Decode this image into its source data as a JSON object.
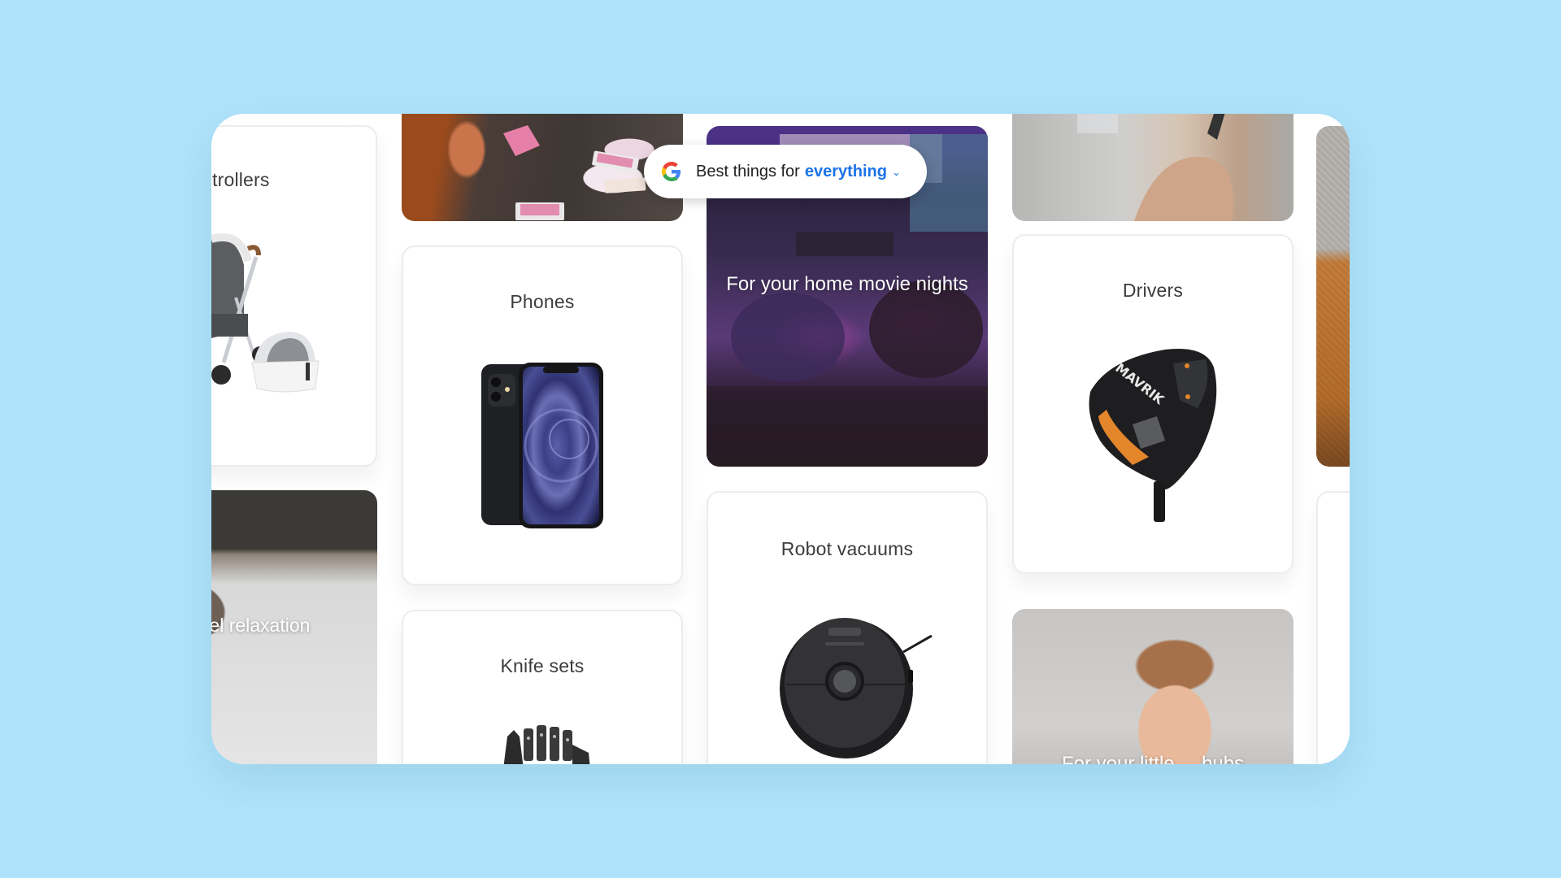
{
  "colors": {
    "background": "#afe3fb",
    "frame": "#ffffff",
    "accent": "#1a73e8",
    "title_text": "#3c3c3c"
  },
  "search_pill": {
    "icon": "google-g-icon",
    "prefix": "Best things for",
    "selected": "everything",
    "chevron_icon": "chevron-down-icon"
  },
  "columns": [
    {
      "cards": [
        {
          "type": "product",
          "title": "trollers",
          "image": "stroller-image"
        },
        {
          "type": "photo",
          "caption": "level relaxation",
          "image": "relaxation-photo"
        }
      ]
    },
    {
      "cards": [
        {
          "type": "photo",
          "caption": "",
          "image": "card-game-photo"
        },
        {
          "type": "product",
          "title": "Phones",
          "image": "smartphone-image"
        },
        {
          "type": "product",
          "title": "Knife sets",
          "image": "knife-set-image"
        }
      ]
    },
    {
      "cards": [
        {
          "type": "photo",
          "caption": "For your home movie nights",
          "image": "movie-night-photo"
        },
        {
          "type": "product",
          "title": "Robot vacuums",
          "image": "robot-vacuum-image"
        }
      ]
    },
    {
      "cards": [
        {
          "type": "photo",
          "caption": "",
          "image": "hands-photo"
        },
        {
          "type": "product",
          "title": "Drivers",
          "image": "golf-driver-image",
          "brand_mark": "MAVRIK"
        },
        {
          "type": "photo",
          "caption": "For your little ... bubs",
          "image": "baby-photo"
        }
      ]
    },
    {
      "cards": [
        {
          "type": "photo",
          "caption": "",
          "image": "sweater-photo"
        },
        {
          "type": "product",
          "title": "",
          "image": ""
        }
      ]
    }
  ]
}
